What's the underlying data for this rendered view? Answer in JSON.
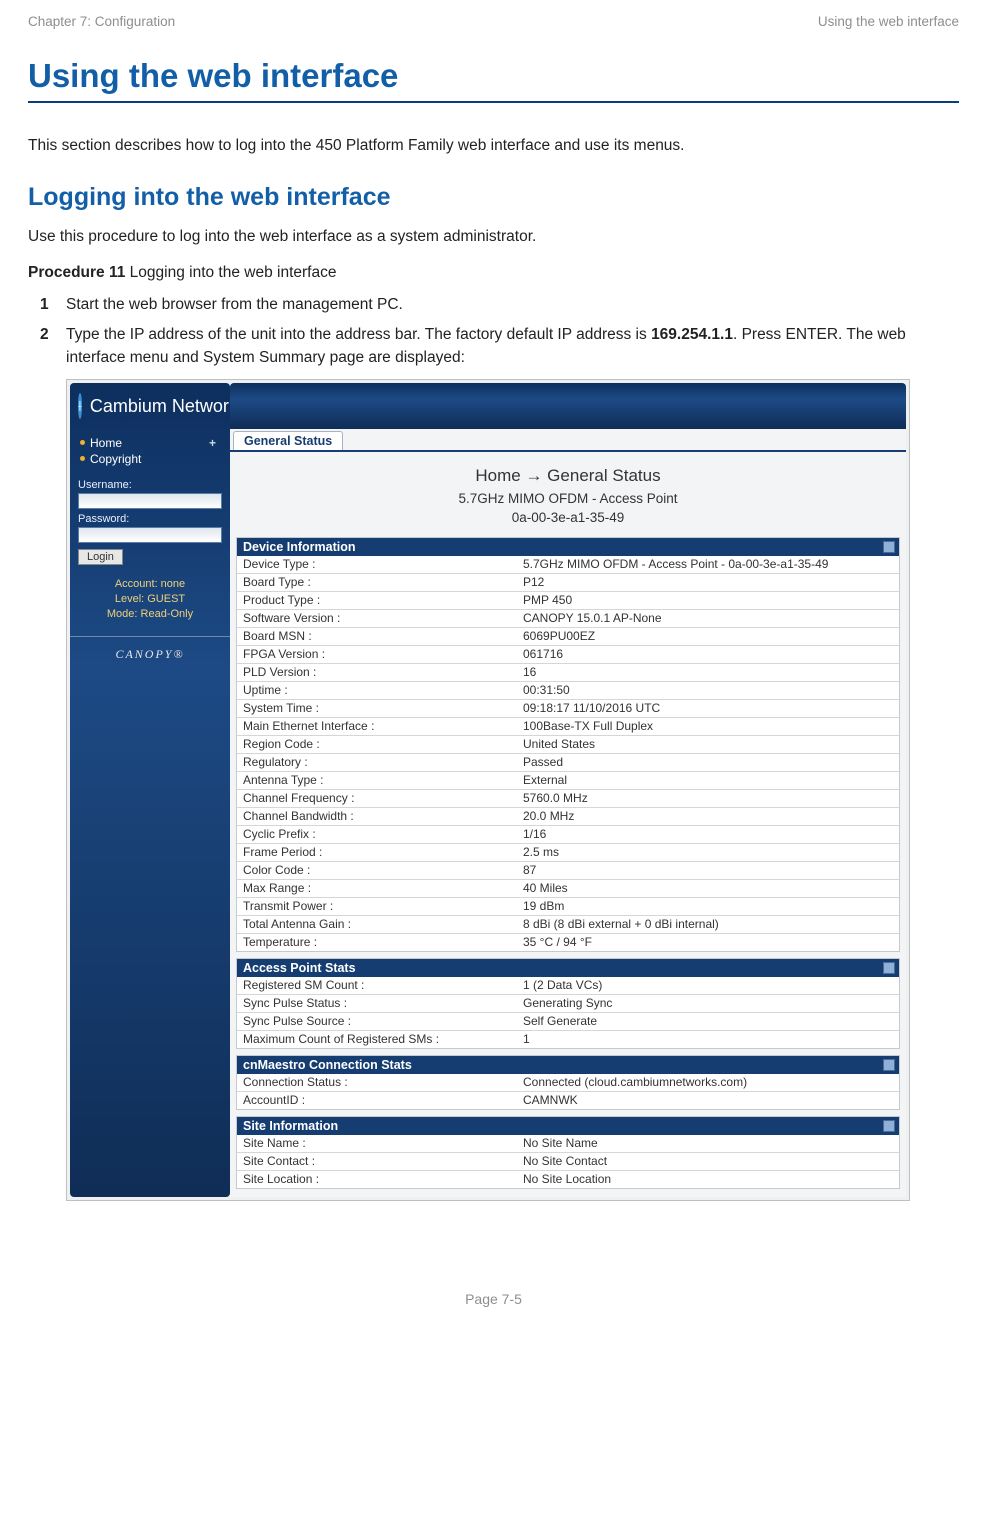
{
  "page_header": {
    "left": "Chapter 7:  Configuration",
    "right": "Using the web interface"
  },
  "page_footer": "Page 7-5",
  "h1": "Using the web interface",
  "intro": "This section describes how to log into the 450 Platform Family web interface and use its menus.",
  "h2": "Logging into the web interface",
  "lead": "Use this procedure to log into the web interface as a system administrator.",
  "procedure_label": "Procedure 11",
  "procedure_title": " Logging into the web interface",
  "steps": {
    "s1_num": "1",
    "s1": "Start the web browser from the management PC.",
    "s2_num": "2",
    "s2_a": "Type the IP address of the unit into the address bar. The factory default IP address is ",
    "s2_bold": "169.254.1.1",
    "s2_b": ". Press ENTER. The web interface menu and System Summary page are displayed:"
  },
  "brand": "Cambium Networks",
  "nav": {
    "home": "Home",
    "copyright": "Copyright"
  },
  "login": {
    "user_lbl": "Username:",
    "pass_lbl": "Password:",
    "btn": "Login"
  },
  "account": {
    "l1": "Account: none",
    "l2": "Level: GUEST",
    "l3": "Mode: Read-Only"
  },
  "canopy": "CANOPY®",
  "tab": "General Status",
  "crumb": "Home → General Status",
  "subcrumb_l1": "5.7GHz MIMO OFDM - Access Point",
  "subcrumb_l2": "0a-00-3e-a1-35-49",
  "sect1_h": "Device Information",
  "device_info": [
    {
      "k": "Device Type :",
      "v": "5.7GHz MIMO OFDM - Access Point - 0a-00-3e-a1-35-49"
    },
    {
      "k": "Board Type :",
      "v": "P12"
    },
    {
      "k": "Product Type :",
      "v": "PMP 450"
    },
    {
      "k": "Software Version :",
      "v": "CANOPY 15.0.1 AP-None"
    },
    {
      "k": "Board MSN :",
      "v": "6069PU00EZ"
    },
    {
      "k": "FPGA Version :",
      "v": "061716"
    },
    {
      "k": "PLD Version :",
      "v": "16"
    },
    {
      "k": "Uptime :",
      "v": "00:31:50"
    },
    {
      "k": "System Time :",
      "v": "09:18:17 11/10/2016 UTC"
    },
    {
      "k": "Main Ethernet Interface :",
      "v": "100Base-TX Full Duplex"
    },
    {
      "k": "Region Code :",
      "v": "United States"
    },
    {
      "k": "Regulatory :",
      "v": "Passed"
    },
    {
      "k": "Antenna Type :",
      "v": "External"
    },
    {
      "k": "Channel Frequency :",
      "v": "5760.0 MHz"
    },
    {
      "k": "Channel Bandwidth :",
      "v": "20.0 MHz"
    },
    {
      "k": "Cyclic Prefix :",
      "v": "1/16"
    },
    {
      "k": "Frame Period :",
      "v": "2.5 ms"
    },
    {
      "k": "Color Code :",
      "v": "87"
    },
    {
      "k": "Max Range :",
      "v": "40 Miles"
    },
    {
      "k": "Transmit Power :",
      "v": "19 dBm"
    },
    {
      "k": "Total Antenna Gain :",
      "v": "8 dBi (8 dBi external + 0 dBi internal)"
    },
    {
      "k": "Temperature :",
      "v": "35 °C / 94 °F"
    }
  ],
  "sect2_h": "Access Point Stats",
  "ap_stats": [
    {
      "k": "Registered SM Count :",
      "v": "1 (2 Data VCs)"
    },
    {
      "k": "Sync Pulse Status :",
      "v": "Generating Sync"
    },
    {
      "k": "Sync Pulse Source :",
      "v": "Self Generate"
    },
    {
      "k": "Maximum Count of Registered SMs :",
      "v": "1"
    }
  ],
  "sect3_h": "cnMaestro Connection Stats",
  "cn_stats": [
    {
      "k": "Connection Status :",
      "v": "Connected (cloud.cambiumnetworks.com)"
    },
    {
      "k": "AccountID :",
      "v": "CAMNWK"
    }
  ],
  "sect4_h": "Site Information",
  "site_info": [
    {
      "k": "Site Name :",
      "v": "No Site Name"
    },
    {
      "k": "Site Contact :",
      "v": "No Site Contact"
    },
    {
      "k": "Site Location :",
      "v": "No Site Location"
    }
  ]
}
